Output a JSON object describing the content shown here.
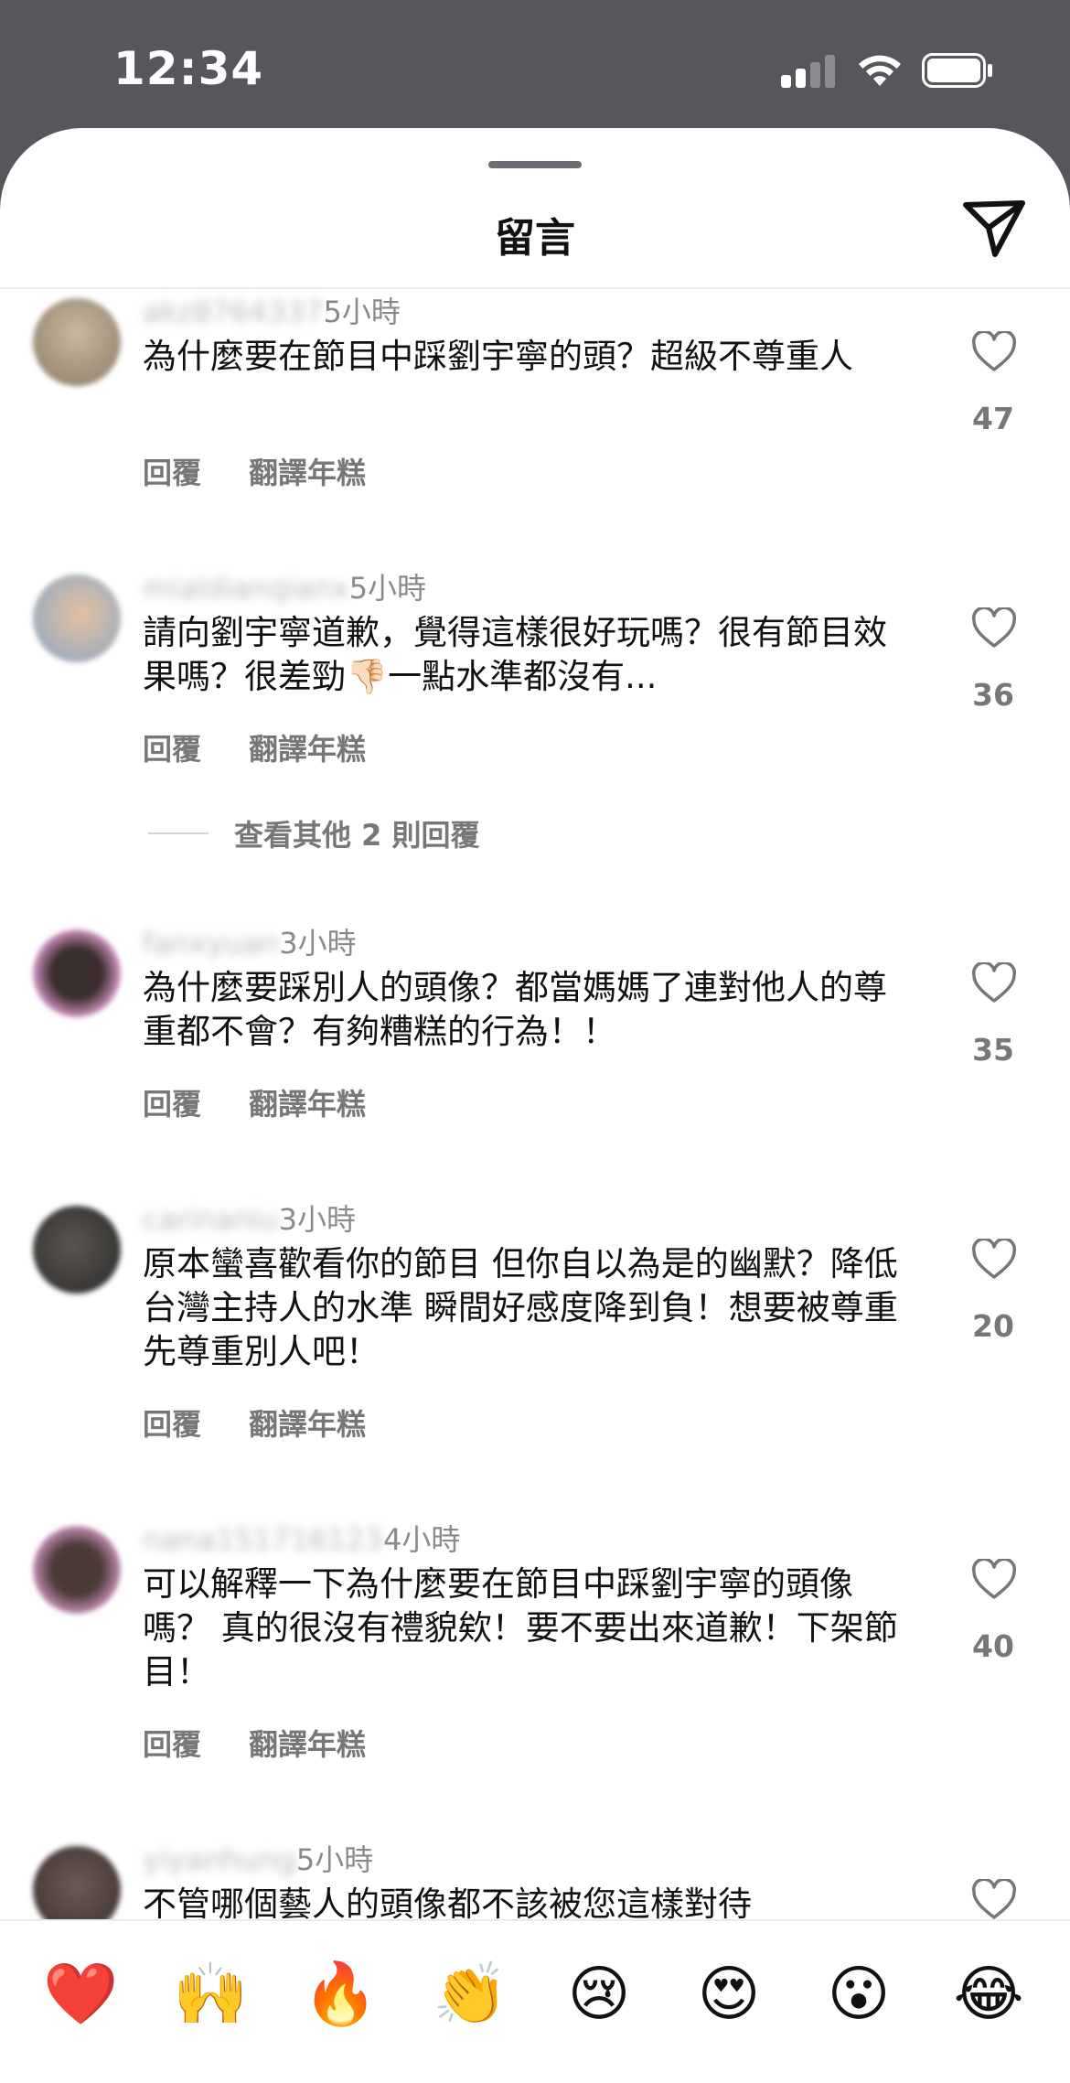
{
  "status_bar": {
    "time": "12:34"
  },
  "sheet": {
    "title": "留言"
  },
  "comments": [
    {
      "time": "5小時",
      "text": "為什麼要在節目中踩劉宇寧的頭？超級不尊重人",
      "actions": [
        "回覆",
        "翻譯年糕"
      ],
      "likes": "47"
    },
    {
      "time": "5小時",
      "text": "請向劉宇寧道歉，覺得這樣很好玩嗎？很有節目效果嗎？很差勁👎🏻一點水準都沒有...",
      "actions": [
        "回覆",
        "翻譯年糕"
      ],
      "likes": "36",
      "view_more": "查看其他 2 則回覆"
    },
    {
      "time": "3小時",
      "text": "為什麼要踩別人的頭像？都當媽媽了連對他人的尊重都不會？有夠糟糕的行為！！",
      "actions": [
        "回覆",
        "翻譯年糕"
      ],
      "likes": "35"
    },
    {
      "time": "3小時",
      "text": "原本蠻喜歡看你的節目 但你自以為是的幽默？降低台灣主持人的水準 瞬間好感度降到負！想要被尊重先尊重別人吧！",
      "actions": [
        "回覆",
        "翻譯年糕"
      ],
      "likes": "20"
    },
    {
      "time": "4小時",
      "text": "可以解釋一下為什麼要在節目中踩劉宇寧的頭像嗎？ 真的很沒有禮貌欸！要不要出來道歉！下架節目！",
      "actions": [
        "回覆",
        "翻譯年糕"
      ],
      "likes": "40"
    },
    {
      "time": "5小時",
      "text": "不管哪個藝人的頭像都不該被您這樣對待",
      "actions": [],
      "likes": ""
    }
  ],
  "emoji_bar": [
    "❤️",
    "🙌",
    "🔥",
    "👏",
    "😢",
    "😍",
    "😮",
    "😂"
  ],
  "colors": {
    "sheet_bg": "#ffffff",
    "backdrop": "#55575c",
    "secondary_text": "#777777"
  }
}
